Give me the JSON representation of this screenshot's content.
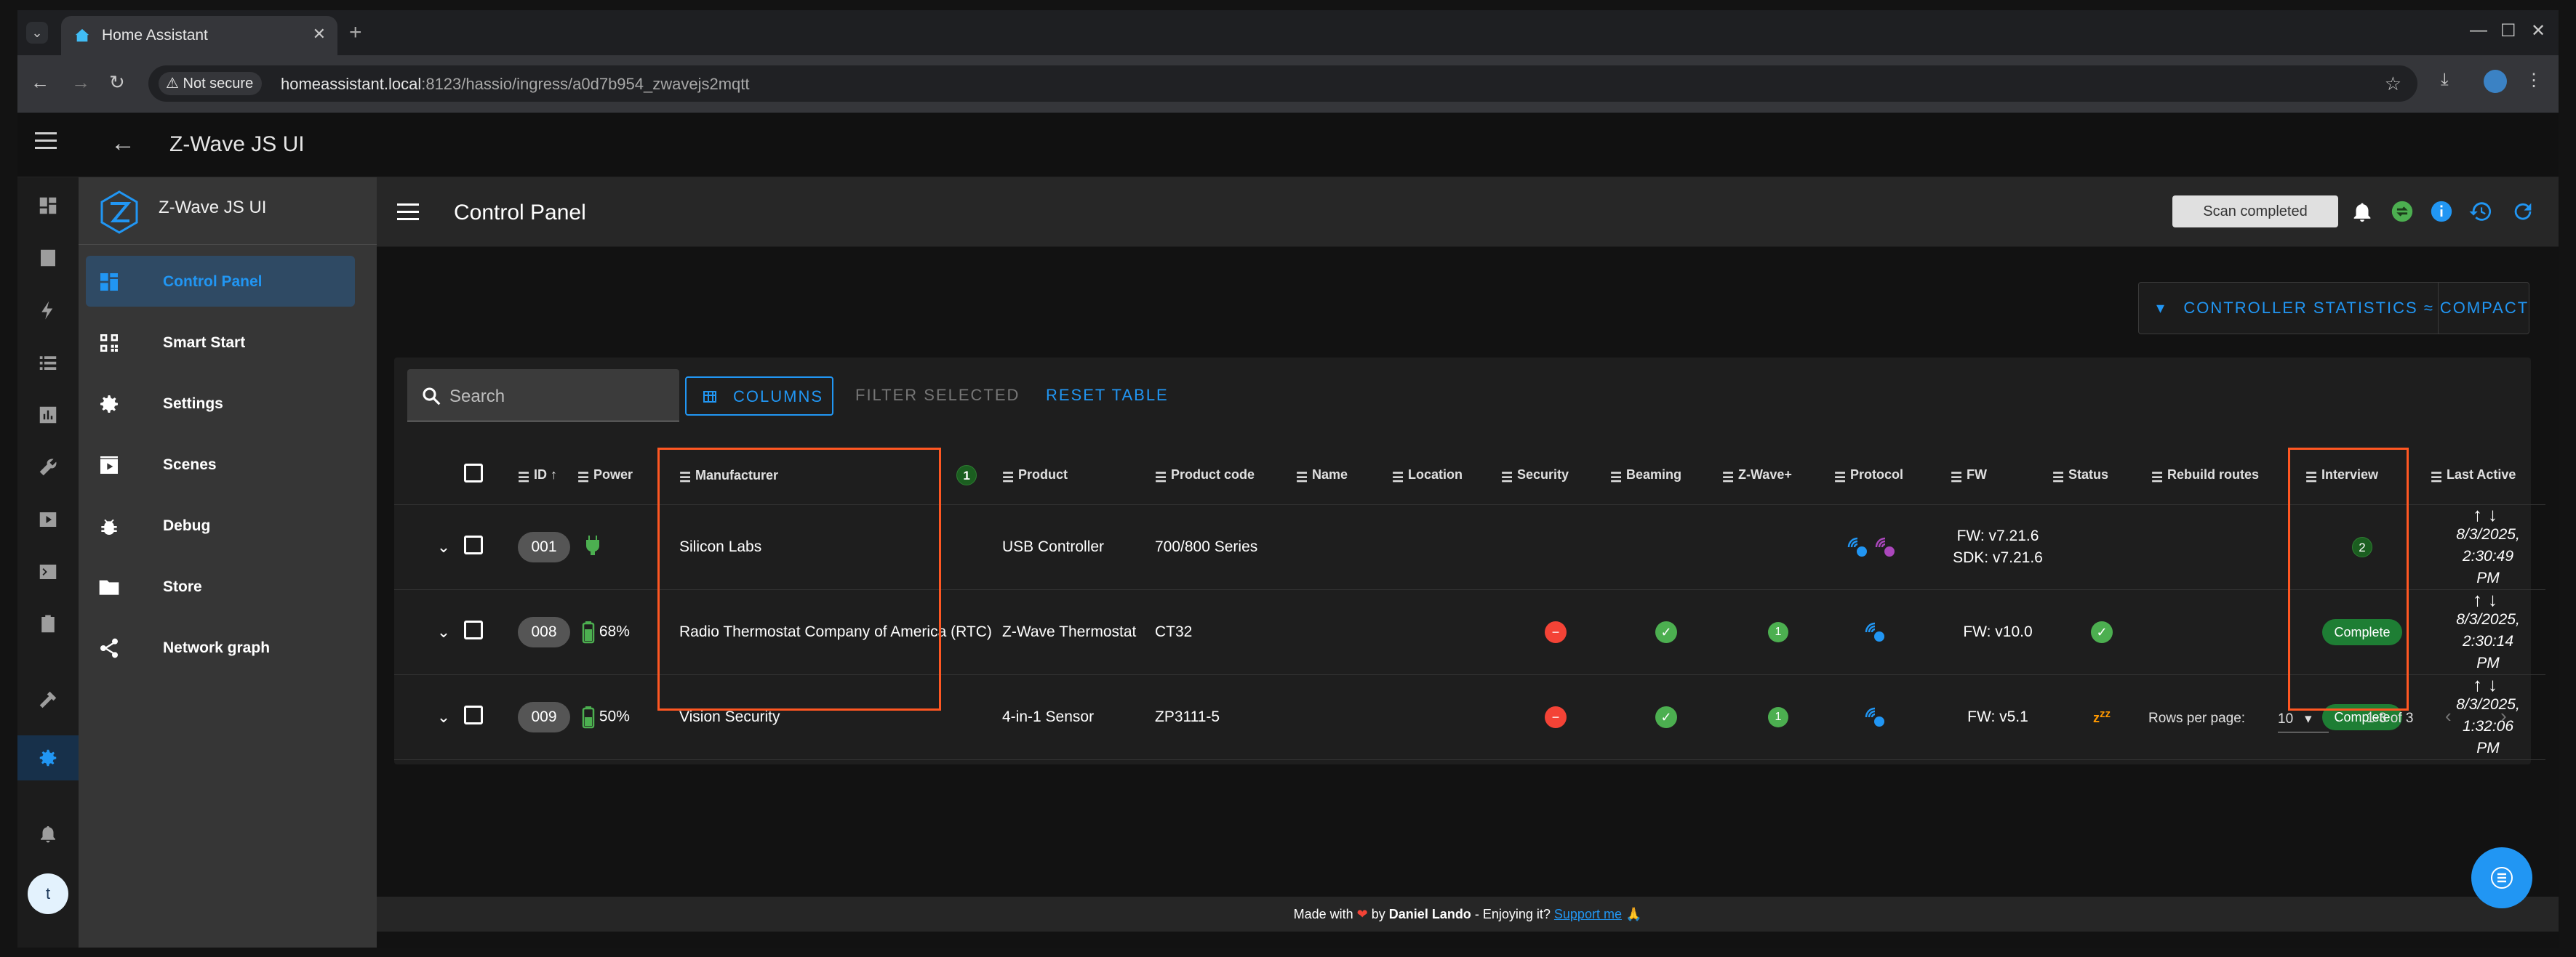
{
  "browser": {
    "tab_title": "Home Assistant",
    "security_label": "Not secure",
    "url_host": "homeassistant.local",
    "url_path": ":8123/hassio/ingress/a0d7b954_zwavejs2mqtt"
  },
  "ha": {
    "title": "Z-Wave JS UI",
    "user_initial": "t"
  },
  "zwave": {
    "brand": "Z-Wave JS UI",
    "nav": [
      {
        "label": "Control Panel",
        "icon": "control-panel-icon",
        "active": true
      },
      {
        "label": "Smart Start",
        "icon": "qr-code-icon"
      },
      {
        "label": "Settings",
        "icon": "gear-icon"
      },
      {
        "label": "Scenes",
        "icon": "scene-icon"
      },
      {
        "label": "Debug",
        "icon": "bug-icon"
      },
      {
        "label": "Store",
        "icon": "folder-icon"
      },
      {
        "label": "Network graph",
        "icon": "share-icon"
      }
    ],
    "page_title": "Control Panel",
    "scan_status": "Scan completed",
    "controller_stats_label": "CONTROLLER STATISTICS",
    "compact_label": "COMPACT",
    "search_placeholder": "Search",
    "columns_label": "COLUMNS",
    "filter_selected_label": "FILTER SELECTED",
    "reset_table_label": "RESET TABLE",
    "headers": [
      "ID",
      "Power",
      "Manufacturer",
      "Product",
      "Product code",
      "Name",
      "Location",
      "Security",
      "Beaming",
      "Z-Wave+",
      "Protocol",
      "FW",
      "Status",
      "Rebuild routes",
      "Interview",
      "Last Active"
    ],
    "annotations": {
      "manufacturer_badge": "1",
      "interview_badge": "2"
    },
    "rows": [
      {
        "id": "001",
        "power": "",
        "manufacturer": "Silicon Labs",
        "product": "USB Controller",
        "product_code": "700/800 Series",
        "security": "",
        "beaming": "",
        "zwave_plus": "",
        "fw_line1": "FW: v7.21.6",
        "fw_line2": "SDK: v7.21.6",
        "status": "",
        "interview": "",
        "last_active_1": "8/3/2025, 2:30:49",
        "last_active_2": "PM"
      },
      {
        "id": "008",
        "power": "68%",
        "manufacturer": "Radio Thermostat Company of America (RTC)",
        "product": "Z-Wave Thermostat",
        "product_code": "CT32",
        "security": "none",
        "beaming": "yes",
        "zwave_plus": "1",
        "fw_line1": "FW: v10.0",
        "fw_line2": "",
        "status": "alive",
        "interview": "Complete",
        "last_active_1": "8/3/2025, 2:30:14",
        "last_active_2": "PM"
      },
      {
        "id": "009",
        "power": "50%",
        "manufacturer": "Vision Security",
        "product": "4-in-1 Sensor",
        "product_code": "ZP3111-5",
        "security": "none",
        "beaming": "yes",
        "zwave_plus": "1",
        "fw_line1": "FW: v5.1",
        "fw_line2": "",
        "status": "asleep",
        "interview": "Complete",
        "last_active_1": "8/3/2025, 1:32:06",
        "last_active_2": "PM"
      }
    ],
    "pagination": {
      "rows_per_page_label": "Rows per page:",
      "rows_per_page": "10",
      "range": "1-3 of 3"
    },
    "footer": {
      "prefix": "Made with",
      "by": "by",
      "author": "Daniel Lando",
      "enjoy": "- Enjoying it?",
      "support": "Support me",
      "emoji": "🙏"
    }
  },
  "colors": {
    "accent": "#2196f3",
    "highlight_box": "#ff5722",
    "complete": "#1e7e34",
    "error": "#f44336"
  }
}
